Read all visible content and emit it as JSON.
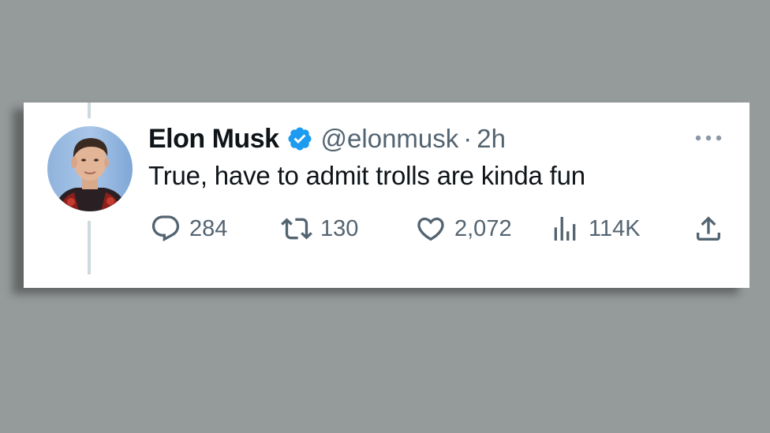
{
  "tweet": {
    "author_name": "Elon Musk",
    "handle": "@elonmusk",
    "separator": "·",
    "time": "2h",
    "text": "True, have to admit trolls are kinda fun",
    "verified_icon": "verified-badge-icon",
    "more_icon": "more-icon"
  },
  "actions": {
    "replies": {
      "icon": "reply-icon",
      "count": "284"
    },
    "retweets": {
      "icon": "retweet-icon",
      "count": "130"
    },
    "likes": {
      "icon": "heart-icon",
      "count": "2,072"
    },
    "views": {
      "icon": "views-icon",
      "count": "114K"
    },
    "share": {
      "icon": "share-icon"
    }
  },
  "colors": {
    "background": "#959a9a",
    "card": "#ffffff",
    "text_primary": "#0f1419",
    "text_secondary": "#536471",
    "verified_blue": "#1d9bf0",
    "thread_line": "#cfd9de"
  }
}
